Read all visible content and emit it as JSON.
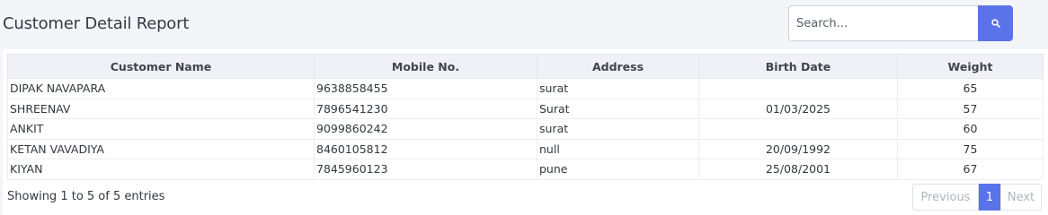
{
  "header": {
    "title": "Customer Detail Report"
  },
  "search": {
    "placeholder": "Search...",
    "value": "",
    "button_icon": "search-icon"
  },
  "table": {
    "columns": [
      "Customer Name",
      "Mobile No.",
      "Address",
      "Birth Date",
      "Weight"
    ],
    "rows": [
      {
        "name": "DIPAK NAVAPARA",
        "mobile": "9638858455",
        "address": "surat",
        "birth_date": "",
        "weight": "65"
      },
      {
        "name": "SHREENAV",
        "mobile": "7896541230",
        "address": "Surat",
        "birth_date": "01/03/2025",
        "weight": "57"
      },
      {
        "name": "ANKIT",
        "mobile": "9099860242",
        "address": "surat",
        "birth_date": "",
        "weight": "60"
      },
      {
        "name": "KETAN VAVADIYA",
        "mobile": "8460105812",
        "address": "null",
        "birth_date": "20/09/1992",
        "weight": "75"
      },
      {
        "name": "KIYAN",
        "mobile": "7845960123",
        "address": "pune",
        "birth_date": "25/08/2001",
        "weight": "67"
      }
    ]
  },
  "footer": {
    "info": "Showing 1 to 5 of 5 entries",
    "pagination": {
      "previous": "Previous",
      "current": "1",
      "next": "Next"
    }
  },
  "colors": {
    "accent": "#5b73e8",
    "background": "#f4f5f9"
  }
}
